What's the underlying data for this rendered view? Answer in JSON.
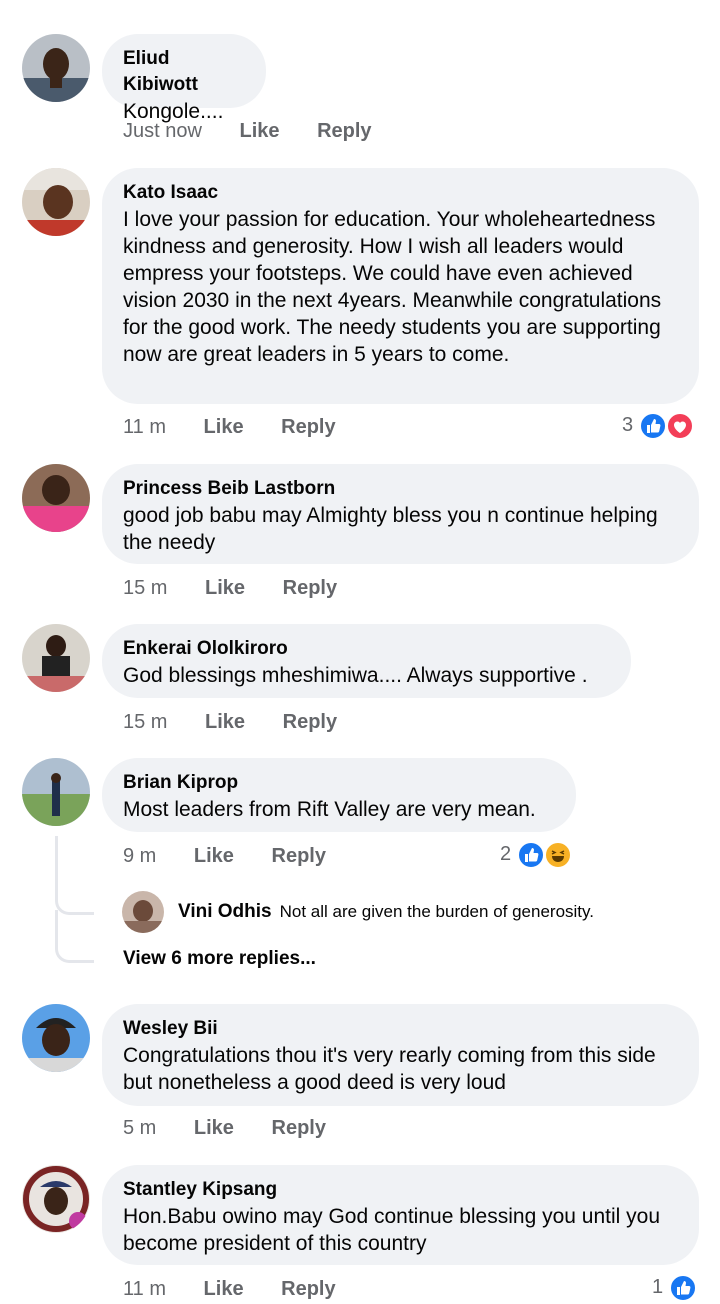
{
  "comments": [
    {
      "name": "Eliud Kibiwott",
      "text": "Kongole....",
      "time": "Just now",
      "like": "Like",
      "reply": "Reply"
    },
    {
      "name": "Kato Isaac",
      "text": "I love your passion for education. Your wholeheartedness kindness and generosity. How I wish all leaders would empress your footsteps. We could have even achieved vision 2030 in the next 4years. Meanwhile congratulations for the good work. The  needy students you are supporting now are great leaders in 5 years to come.",
      "time": "11 m",
      "like": "Like",
      "reply": "Reply",
      "reaction_count": "3",
      "reaction_icons": [
        "like-icon",
        "love-icon"
      ]
    },
    {
      "name": "Princess Beib Lastborn",
      "text": "good job babu may Almighty bless you n continue helping the needy",
      "time": "15 m",
      "like": "Like",
      "reply": "Reply"
    },
    {
      "name": "Enkerai Ololkiroro",
      "text": "God blessings mheshimiwa.... Always supportive .",
      "time": "15 m",
      "like": "Like",
      "reply": "Reply"
    },
    {
      "name": "Brian Kiprop",
      "text": "Most leaders from Rift Valley are very mean.",
      "time": "9 m",
      "like": "Like",
      "reply": "Reply",
      "reaction_count": "2",
      "reaction_icons": [
        "like-icon",
        "haha-icon"
      ],
      "reply_preview": {
        "name": "Vini Odhis",
        "text": "Not all are given the burden of generosity."
      },
      "more_replies": "View 6 more replies..."
    },
    {
      "name": "Wesley Bii",
      "text": "Congratulations thou it's very rearly coming from this side but nonetheless a good deed is very loud",
      "time": "5 m",
      "like": "Like",
      "reply": "Reply"
    },
    {
      "name": "Stantley Kipsang",
      "text": "Hon.Babu owino may God continue blessing you until you become president of this country",
      "time": "11 m",
      "like": "Like",
      "reply": "Reply",
      "reaction_count": "1",
      "reaction_icons": [
        "like-icon"
      ]
    }
  ],
  "colors": {
    "bubble": "#f0f2f5",
    "meta_text": "#65676b",
    "like_blue": "#1877f2",
    "love_red": "#f33e58",
    "haha_yellow": "#f7b125",
    "thread_line": "#e4e6eb"
  }
}
